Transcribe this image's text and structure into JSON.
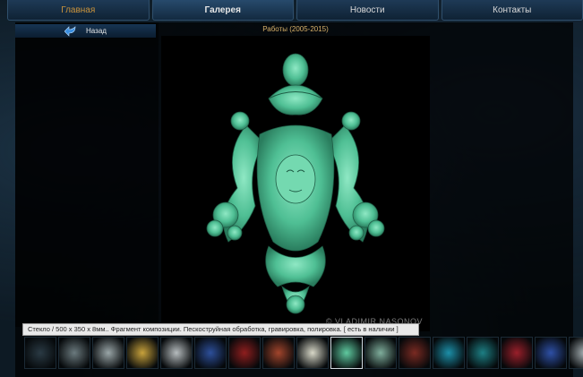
{
  "nav": {
    "items": [
      {
        "label": "Главная"
      },
      {
        "label": "Галерея"
      },
      {
        "label": "Новости"
      },
      {
        "label": "Контакты"
      }
    ],
    "accent_color": "#c9933c"
  },
  "back_button": {
    "label": "Назад",
    "icon": "back-arrow-icon"
  },
  "gallery": {
    "title": "Работы (2005-2015)",
    "watermark": "© VLADIMIR NASONOV",
    "description": "Стекло / 500 x 350 x 8мм.. Фрагмент композиции. Пескоструйная обработка, гравировка, полировка. [ есть в наличии ]",
    "main_image_color": "#5fcaa0",
    "thumbnails": [
      {
        "name": "thumb-1",
        "color": "#2a3a44"
      },
      {
        "name": "thumb-2",
        "color": "#6b7a7e"
      },
      {
        "name": "thumb-3",
        "color": "#9aa6a8"
      },
      {
        "name": "thumb-4",
        "color": "#c8a23c"
      },
      {
        "name": "thumb-5",
        "color": "#b6bcbe"
      },
      {
        "name": "thumb-6",
        "color": "#2d4f9a"
      },
      {
        "name": "thumb-7",
        "color": "#8f1e1e"
      },
      {
        "name": "thumb-8",
        "color": "#a2452c"
      },
      {
        "name": "thumb-9",
        "color": "#d8d8c8"
      },
      {
        "name": "thumb-10",
        "color": "#5fcaa0",
        "selected": true
      },
      {
        "name": "thumb-11",
        "color": "#7fae9c"
      },
      {
        "name": "thumb-12",
        "color": "#7a2a22"
      },
      {
        "name": "thumb-13",
        "color": "#1c8fa8"
      },
      {
        "name": "thumb-14",
        "color": "#1d7f84"
      },
      {
        "name": "thumb-15",
        "color": "#9a1f2a"
      },
      {
        "name": "thumb-16",
        "color": "#2e50a6"
      },
      {
        "name": "thumb-17",
        "color": "#aab4b8"
      }
    ]
  }
}
